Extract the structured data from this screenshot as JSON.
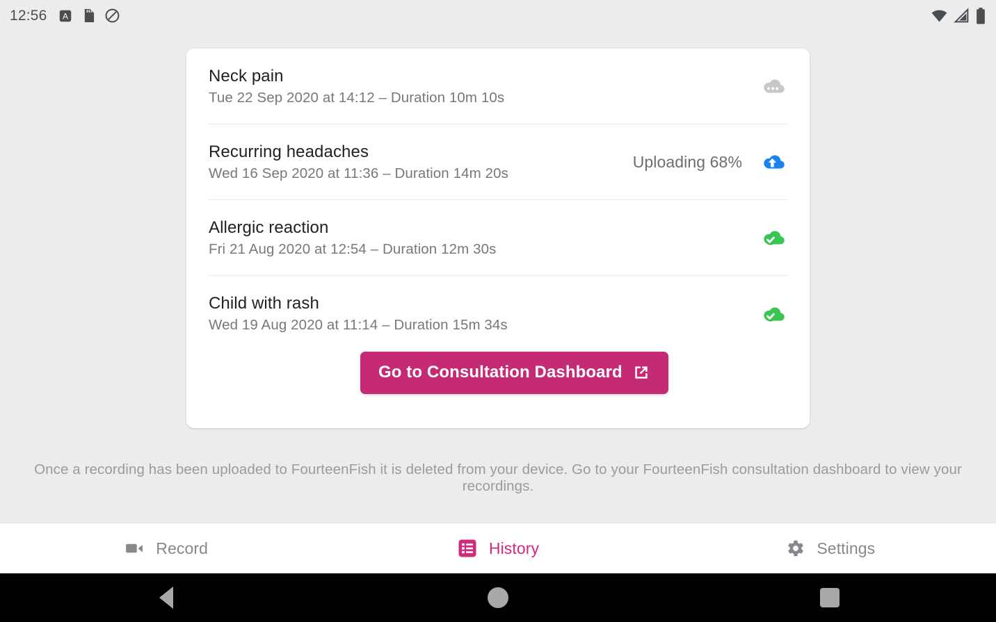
{
  "status_bar": {
    "time": "12:56",
    "left_icons": [
      "app-badge-icon",
      "sd-card-icon",
      "do-not-disturb-icon"
    ],
    "right_icons": [
      "wifi-icon",
      "cell-signal-icon",
      "battery-icon"
    ]
  },
  "recordings": [
    {
      "title": "Neck pain",
      "subtitle": "Tue 22 Sep 2020 at 14:12 – Duration 10m 10s",
      "status_text": "",
      "status_icon": "cloud-pending-icon",
      "status_color": "#c6c7c9"
    },
    {
      "title": "Recurring headaches",
      "subtitle": "Wed 16 Sep 2020 at 11:36 – Duration 14m 20s",
      "status_text": "Uploading 68%",
      "status_icon": "cloud-upload-icon",
      "status_color": "#1a83f0"
    },
    {
      "title": "Allergic reaction",
      "subtitle": "Fri 21 Aug 2020 at 12:54 – Duration 12m 30s",
      "status_text": "",
      "status_icon": "cloud-done-icon",
      "status_color": "#39c551"
    },
    {
      "title": "Child with rash",
      "subtitle": "Wed 19 Aug 2020 at 11:14 – Duration 15m 34s",
      "status_text": "",
      "status_icon": "cloud-done-icon",
      "status_color": "#39c551"
    }
  ],
  "cta": {
    "label": "Go to Consultation Dashboard",
    "icon": "external-link-icon",
    "background": "#c52b74"
  },
  "footer_note": "Once a recording has been uploaded to FourteenFish it is deleted from your device. Go to your FourteenFish consultation dashboard to view your recordings.",
  "bottom_nav": {
    "active_color": "#cf2a7c",
    "inactive_color": "#86888b",
    "items": [
      {
        "label": "Record",
        "icon": "videocam-icon",
        "active": false
      },
      {
        "label": "History",
        "icon": "list-icon",
        "active": true
      },
      {
        "label": "Settings",
        "icon": "gear-icon",
        "active": false
      }
    ]
  },
  "system_nav": {
    "back": "back-triangle-icon",
    "home": "home-circle-icon",
    "recents": "recents-square-icon"
  }
}
